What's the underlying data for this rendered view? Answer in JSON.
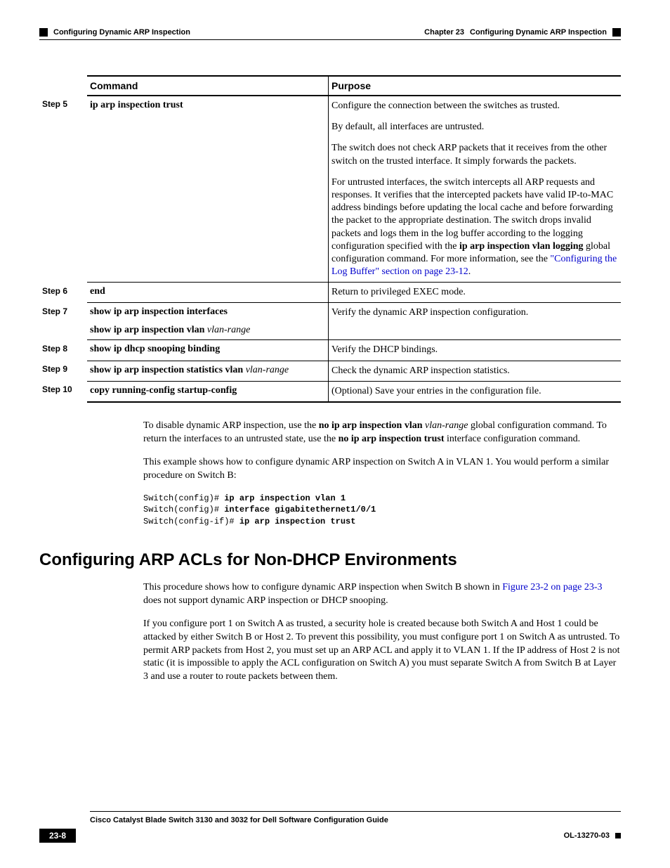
{
  "header": {
    "chapter": "Chapter 23",
    "chapter_title": "Configuring Dynamic ARP Inspection",
    "section": "Configuring Dynamic ARP Inspection"
  },
  "table": {
    "headers": {
      "blank": "",
      "command": "Command",
      "purpose": "Purpose"
    },
    "rows": [
      {
        "step": "Step 5",
        "command_b": "ip arp inspection trust",
        "command_i": "",
        "purpose_html": "Configure the connection between the switches as trusted.|By default, all interfaces are untrusted.|The switch does not check ARP packets that it receives from the other switch on the trusted interface. It simply forwards the packets.|For untrusted interfaces, the switch intercepts all ARP requests and responses. It verifies that the intercepted packets have valid IP-to-MAC address bindings before updating the local cache and before forwarding the packet to the appropriate destination. The switch drops invalid packets and logs them in the log buffer according to the logging configuration specified with the <b>ip arp inspection vlan logging</b> global configuration command. For more information, see the <span class=\"link\">\"Configuring the Log Buffer\" section on page 23-12</span>."
      },
      {
        "step": "Step 6",
        "command_b": "end",
        "command_i": "",
        "purpose_html": "Return to privileged EXEC mode."
      },
      {
        "step": "Step 7",
        "command_b": "show ip arp inspection interfaces",
        "command_i": "",
        "command_line2_b": "show ip arp inspection vlan",
        "command_line2_i": "vlan-range",
        "purpose_html": "Verify the dynamic ARP inspection configuration."
      },
      {
        "step": "Step 8",
        "command_b": "show ip dhcp snooping binding",
        "command_i": "",
        "purpose_html": "Verify the DHCP bindings."
      },
      {
        "step": "Step 9",
        "command_b": "show ip arp inspection statistics vlan",
        "command_i": "vlan-range",
        "purpose_html": "Check the dynamic ARP inspection statistics."
      },
      {
        "step": "Step 10",
        "command_b": "copy running-config startup-config",
        "command_i": "",
        "purpose_html": "(Optional) Save your entries in the configuration file."
      }
    ]
  },
  "body": {
    "p1_pre": "To disable dynamic ARP inspection, use the ",
    "p1_b1": "no ip arp inspection vlan",
    "p1_mid1": " ",
    "p1_i1": "vlan-range",
    "p1_mid2": " global configuration command. To return the interfaces to an untrusted state, use the ",
    "p1_b2": "no ip arp inspection trust",
    "p1_post": " interface configuration command.",
    "p2": "This example shows how to configure dynamic ARP inspection on Switch A in VLAN 1. You would perform a similar procedure on Switch B:",
    "code_l1_a": "Switch(config)# ",
    "code_l1_b": "ip arp inspection vlan 1",
    "code_l2_a": "Switch(config)# ",
    "code_l2_b": "interface gigabitethernet1/0/1",
    "code_l3_a": "Switch(config-if)# ",
    "code_l3_b": "ip arp inspection trust"
  },
  "section2": {
    "title": "Configuring ARP ACLs for Non-DHCP Environments",
    "p1_pre": "This procedure shows how to configure dynamic ARP inspection when Switch B shown in ",
    "p1_link": "Figure 23-2 on page 23-3",
    "p1_post": " does not support dynamic ARP inspection or DHCP snooping.",
    "p2": "If you configure port 1 on Switch A as trusted, a security hole is created because both Switch A and Host 1 could be attacked by either Switch B or Host 2. To prevent this possibility, you must configure port 1 on Switch A as untrusted. To permit ARP packets from Host 2, you must set up an ARP ACL and apply it to VLAN 1. If the IP address of Host 2 is not static (it is impossible to apply the ACL configuration on Switch A) you must separate Switch A from Switch B at Layer 3 and use a router to route packets between them."
  },
  "footer": {
    "title": "Cisco Catalyst Blade Switch 3130 and 3032 for Dell Software Configuration Guide",
    "page": "23-8",
    "docid": "OL-13270-03"
  }
}
